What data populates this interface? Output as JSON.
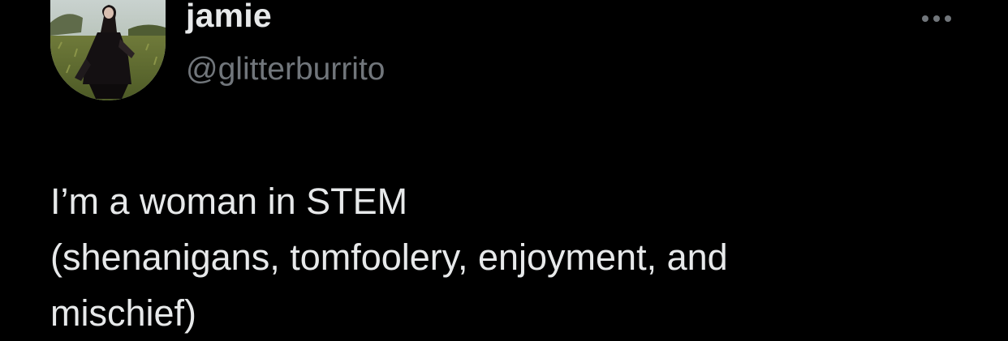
{
  "tweet": {
    "author": {
      "display_name": "jamie",
      "handle": "@glitterburrito",
      "avatar_icon": "profile-photo"
    },
    "more_icon": "more-horizontal-icon",
    "text": "I’m a woman in STEM\n(shenanigans, tomfoolery, enjoyment, and\nmischief)"
  },
  "colors": {
    "background": "#000000",
    "primary_text": "#e7e9ea",
    "secondary_text": "#71767b"
  }
}
